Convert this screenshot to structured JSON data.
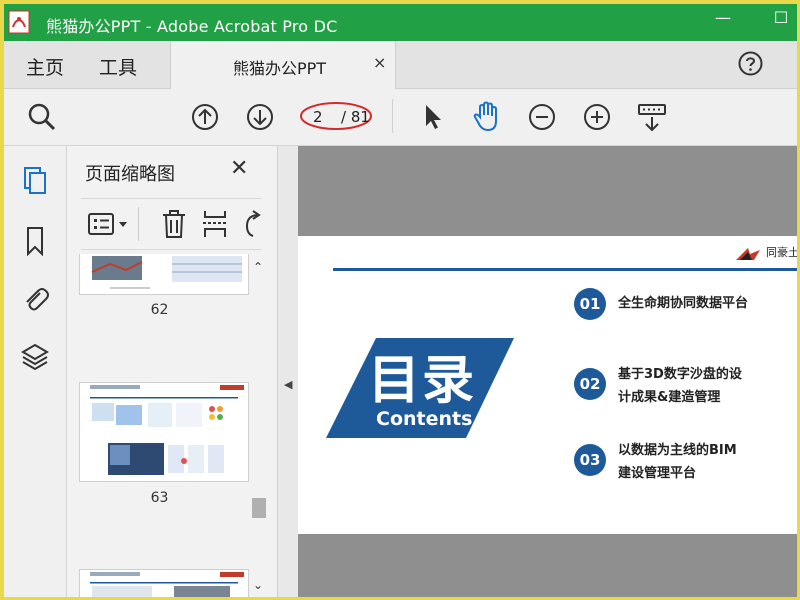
{
  "window": {
    "title": "熊猫办公PPT - Adobe Acrobat Pro DC",
    "minimize_glyph": "—",
    "maximize_glyph": "☐"
  },
  "tabs": {
    "home": "主页",
    "tools": "工具",
    "document_tab": "熊猫办公PPT",
    "close_glyph": "×"
  },
  "toolbar": {
    "current_page": "2",
    "total_pages": "/ 81",
    "icons": [
      "search-icon",
      "page-up-icon",
      "page-down-icon",
      "select-cursor-icon",
      "hand-tool-icon",
      "zoom-out-icon",
      "zoom-in-icon",
      "keyboard-scroll-icon"
    ]
  },
  "rail": {
    "items": [
      "page-thumbnails-icon",
      "bookmark-icon",
      "attachment-icon",
      "layers-icon"
    ]
  },
  "thumbnail_panel": {
    "title": "页面缩略图",
    "close_glyph": "✕",
    "thumbnails": [
      {
        "page": "62"
      },
      {
        "page": "63"
      }
    ]
  },
  "document_page": {
    "brand_text": "同豪土",
    "banner_title": "目录",
    "banner_subtitle": "Contents",
    "items": [
      {
        "num": "01",
        "line1": "全生命期协同数据平台",
        "line2": ""
      },
      {
        "num": "02",
        "line1": "基于3D数字沙盘的设",
        "line2": "计成果&建造管理"
      },
      {
        "num": "03",
        "line1": "以数据为主线的BIM",
        "line2": "建设管理平台"
      }
    ]
  },
  "colors": {
    "titlebar": "#21a045",
    "accent_blue": "#1e5a9a",
    "hand_tool": "#1a73c8",
    "annotation_red": "#d42a2a"
  }
}
